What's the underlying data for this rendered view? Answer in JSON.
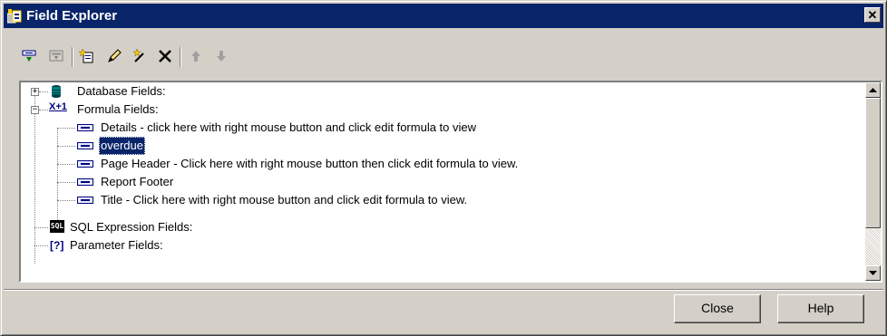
{
  "window": {
    "title": "Field Explorer",
    "close_glyph": "✕"
  },
  "toolbar": {
    "buttons": [
      {
        "icon": "insert-to-report-icon"
      },
      {
        "icon": "browse-data-icon"
      },
      {
        "icon": "new-icon"
      },
      {
        "icon": "edit-icon"
      },
      {
        "icon": "rename-icon"
      },
      {
        "icon": "delete-icon"
      },
      {
        "icon": "move-up-icon"
      },
      {
        "icon": "move-down-icon"
      }
    ]
  },
  "tree": {
    "database_fields": {
      "label": "Database Fields:",
      "expander": "+"
    },
    "formula_fields": {
      "label": "Formula Fields:",
      "expander": "−",
      "icon_text": "X+1",
      "items": [
        "Details - click here with right mouse button and click edit formula to view",
        "overdue",
        "Page Header - Click here with right mouse button then click edit formula to view.",
        "Report Footer",
        "Title - Click here with right mouse button and click edit formula to view."
      ],
      "selected_index": 1
    },
    "sql_expression_fields": {
      "label": "SQL Expression Fields:",
      "icon_text": "SQL"
    },
    "parameter_fields": {
      "label": "Parameter Fields:",
      "icon_text": "[?]"
    }
  },
  "buttons": {
    "close": "Close",
    "help": "Help"
  },
  "colors": {
    "titlebar": "#0a246a",
    "face": "#d4d0c8",
    "selection": "#0a246a"
  }
}
